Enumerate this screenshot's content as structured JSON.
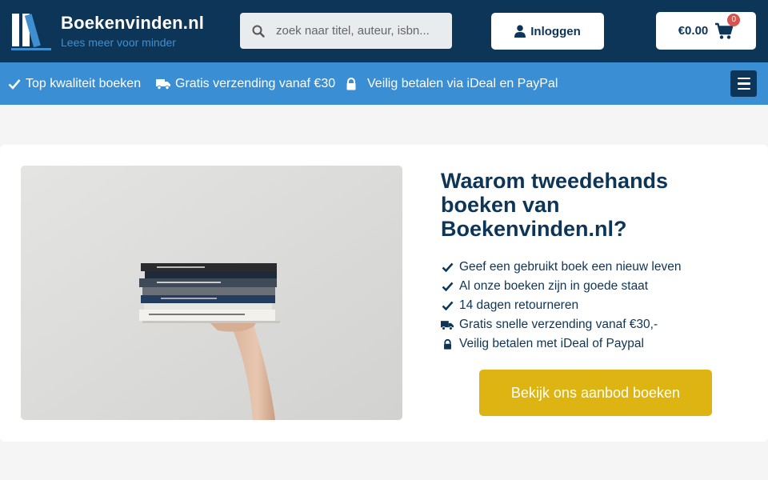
{
  "header": {
    "logo_title": "Boekenvinden.nl",
    "logo_tagline": "Lees meer voor minder",
    "search_placeholder": "zoek naar titel, auteur, isbn...",
    "login_label": "Inloggen",
    "cart_total": "€0.00",
    "cart_count": "0"
  },
  "usps": [
    {
      "icon": "check-icon",
      "label": "Top kwaliteit boeken"
    },
    {
      "icon": "truck-icon",
      "label": "Gratis verzending vanaf €30"
    },
    {
      "icon": "lock-icon",
      "label": "Veilig betalen via iDeal en PayPal"
    }
  ],
  "main": {
    "heading": "Waarom tweedehands boeken van Boekenvinden.nl?",
    "features": [
      {
        "icon": "check-icon",
        "label": "Geef een gebruikt boek een nieuw leven"
      },
      {
        "icon": "check-icon",
        "label": "Al onze boeken zijn in goede staat"
      },
      {
        "icon": "check-icon",
        "label": "14 dagen retourneren"
      },
      {
        "icon": "truck-icon",
        "label": "Gratis snelle verzending vanaf €30,-"
      },
      {
        "icon": "lock-icon",
        "label": "Veilig betalen met iDeal of Paypal"
      }
    ],
    "cta_label": "Bekijk ons aanbod boeken"
  },
  "colors": {
    "navy": "#0d3557",
    "blue": "#3a8ed3",
    "gold": "#deb412"
  }
}
